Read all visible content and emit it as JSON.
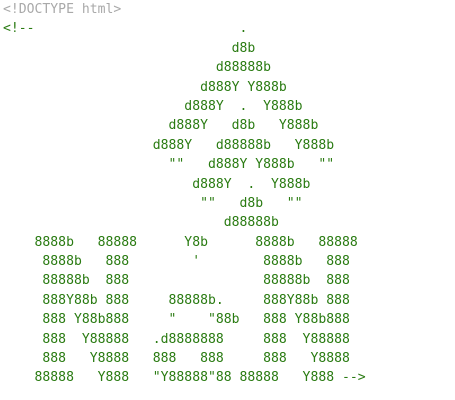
{
  "source": {
    "doctype": "<!DOCTYPE html>",
    "comment_lines": [
      "<!--                          .",
      "                             d8b",
      "                           d88888b",
      "                         d888Y Y888b",
      "                       d888Y  .  Y888b",
      "                     d888Y   d8b   Y888b",
      "                   d888Y   d88888b   Y888b",
      "                     \"\"   d888Y Y888b   \"\"",
      "                        d888Y  .  Y888b",
      "                         \"\"   d8b   \"\"",
      "                            d88888b",
      "    8888b   88888      Y8b      8888b   88888",
      "     8888b   888        '        8888b   888",
      "     88888b  888                 88888b  888",
      "     888Y88b 888     88888b.     888Y88b 888",
      "     888 Y88b888     \"    \"88b   888 Y88b888",
      "     888  Y88888   .d8888888     888  Y88888",
      "     888   Y8888   888   888     888   Y8888",
      "    88888   Y888   \"Y88888\"88 88888   Y888 -->"
    ]
  },
  "colors": {
    "doctype": "#a9a9a9",
    "comment": "#2a7b12"
  }
}
